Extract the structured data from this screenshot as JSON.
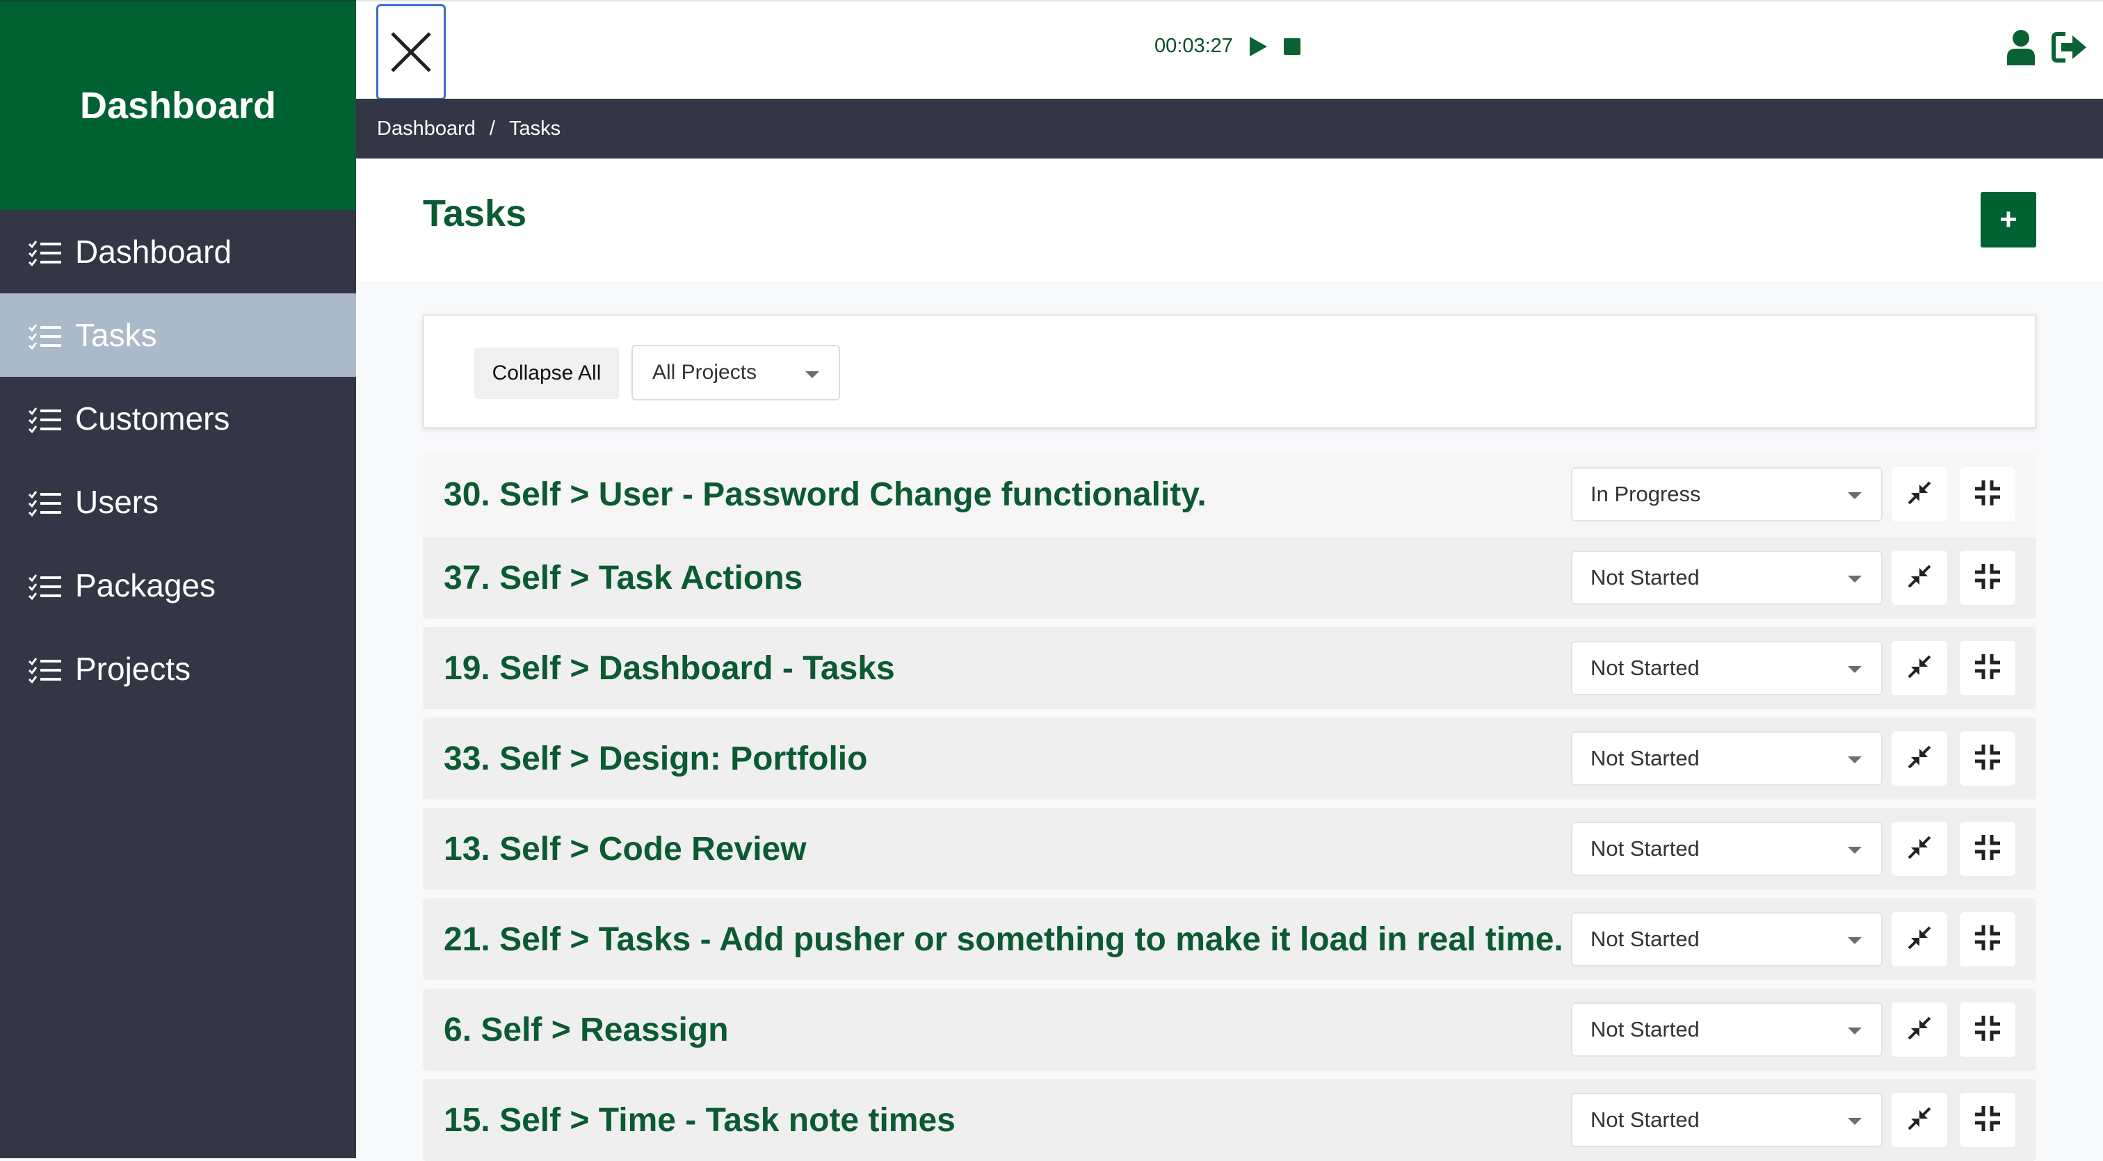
{
  "sidebar": {
    "brand": "Dashboard",
    "items": [
      {
        "label": "Dashboard",
        "icon": "list-check-icon",
        "active": false
      },
      {
        "label": "Tasks",
        "icon": "list-check-icon",
        "active": true
      },
      {
        "label": "Customers",
        "icon": "list-check-icon",
        "active": false
      },
      {
        "label": "Users",
        "icon": "list-check-icon",
        "active": false
      },
      {
        "label": "Packages",
        "icon": "list-check-icon",
        "active": false
      },
      {
        "label": "Projects",
        "icon": "list-check-icon",
        "active": false
      }
    ]
  },
  "topbar": {
    "close_icon": "close-icon",
    "timer": "00:03:27",
    "play_icon": "play-icon",
    "stop_icon": "stop-icon",
    "user_icon": "user-icon",
    "logout_icon": "logout-icon"
  },
  "breadcrumb": {
    "items": [
      "Dashboard",
      "Tasks"
    ],
    "separator": "/"
  },
  "page": {
    "title": "Tasks",
    "add_label": "+"
  },
  "filters": {
    "collapse_label": "Collapse All",
    "project_selected": "All Projects"
  },
  "tasks": [
    {
      "title": "30. Self > User - Password Change functionality.",
      "status": "In Progress"
    },
    {
      "title": "37. Self > Task Actions",
      "status": "Not Started"
    },
    {
      "title": "19. Self > Dashboard - Tasks",
      "status": "Not Started"
    },
    {
      "title": "33. Self > Design: Portfolio",
      "status": "Not Started"
    },
    {
      "title": "13. Self > Code Review",
      "status": "Not Started"
    },
    {
      "title": "21. Self > Tasks - Add pusher or something to make it load in real time.",
      "status": "Not Started"
    },
    {
      "title": "6. Self > Reassign",
      "status": "Not Started"
    },
    {
      "title": "15. Self > Time - Task note times",
      "status": "Not Started"
    }
  ],
  "colors": {
    "brand_green": "#006232",
    "sidebar_bg": "#343646",
    "active_item": "#aabac8",
    "title_green": "#0b5a32"
  }
}
